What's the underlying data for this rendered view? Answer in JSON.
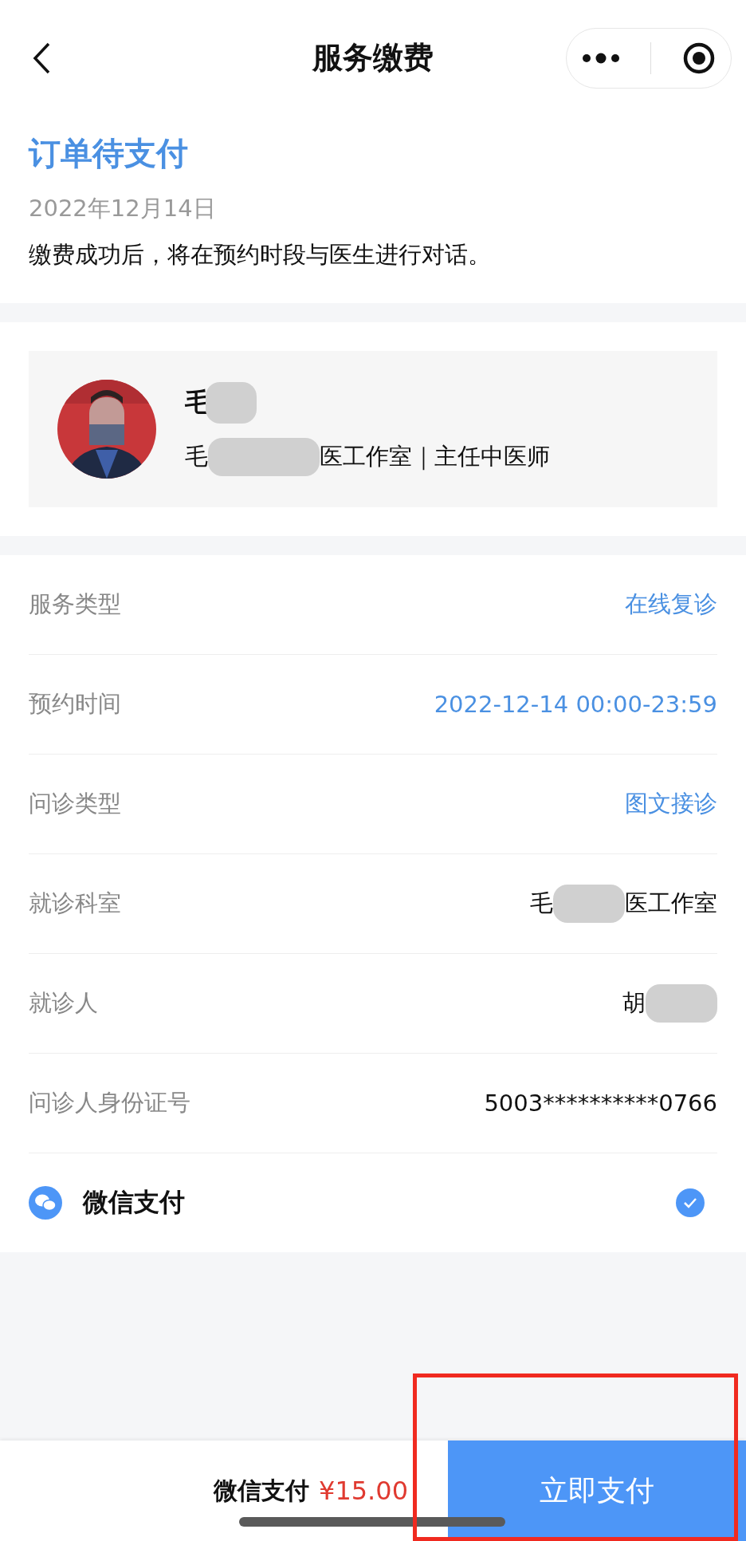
{
  "nav": {
    "title": "服务缴费"
  },
  "order": {
    "status": "订单待支付",
    "date": "2022年12月14日",
    "note": "缴费成功后，将在预约时段与医生进行对话。"
  },
  "doctor": {
    "name": "毛",
    "subtitle_before": "毛",
    "subtitle_after": "医工作室｜主任中医师"
  },
  "details": [
    {
      "label": "服务类型",
      "value": "在线复诊",
      "color": "#4a90e2"
    },
    {
      "label": "预约时间",
      "value": "2022-12-14 00:00-23:59",
      "color": "#4a90e2"
    },
    {
      "label": "问诊类型",
      "value": "图文接诊",
      "color": "#4a90e2"
    },
    {
      "label": "就诊科室",
      "value_before": "毛",
      "value": "医工作室",
      "color": "#111111"
    },
    {
      "label": "就诊人",
      "value_before": "胡",
      "color": "#111111"
    },
    {
      "label": "问诊人身份证号",
      "value": "5003**********0766",
      "color": "#111111"
    }
  ],
  "payment_methods": [
    {
      "label": "微信支付",
      "selected": true
    }
  ],
  "footer": {
    "method": "微信支付",
    "price": "¥15.00",
    "pay_button": "立即支付"
  }
}
